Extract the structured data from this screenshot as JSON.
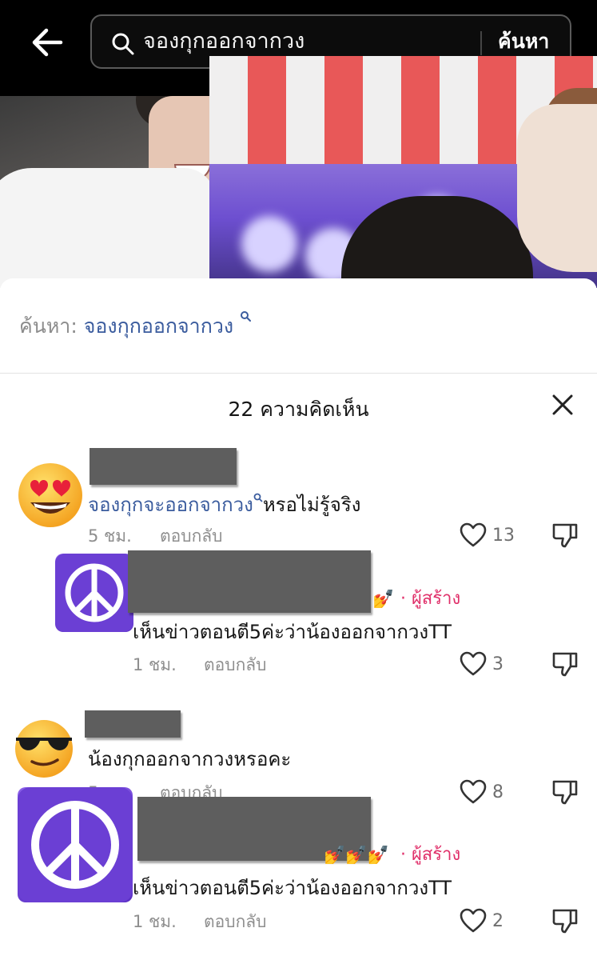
{
  "header": {
    "search_query": "จองกุกออกจากวง",
    "search_button": "ค้นหา"
  },
  "related_search": {
    "label": "ค้นหา:",
    "keyword": "จองกุกออกจากวง"
  },
  "comments_panel": {
    "count_label": "22 ความคิดเห็น"
  },
  "comments": [
    {
      "text_link": "จองกุกจะออกจากวง",
      "text_rest": "หรอไม่รู้จริง",
      "time": "5 ชม.",
      "reply": "ตอบกลับ",
      "likes": "13"
    },
    {
      "is_reply": true,
      "creator_badge": "· ผู้สร้าง",
      "text": "เห็นข่าวตอนตี5ค่ะว่าน้องออกจากวงTT",
      "time": "1 ชม.",
      "reply": "ตอบกลับ",
      "likes": "3"
    },
    {
      "text": "น้องกุกออกจากวงหรอคะ",
      "time": "5 ชม.",
      "reply": "ตอบกลับ",
      "likes": "8"
    },
    {
      "is_reply": true,
      "creator_badge": "· ผู้สร้าง",
      "text": "เห็นข่าวตอนตี5ค่ะว่าน้องออกจากวงTT",
      "time": "1 ชม.",
      "reply": "ตอบกลับ",
      "likes": "2"
    }
  ],
  "icons": {
    "back": "arrow-left-icon",
    "search": "search-icon",
    "close": "close-icon",
    "like": "heart-icon",
    "dislike": "thumbs-down-icon",
    "avatar1": "heart-eyes-emoji",
    "avatar2": "peace-symbol",
    "avatar3": "sunglasses-emoji"
  },
  "colors": {
    "link": "#3b5c9e",
    "creator": "#e0306a",
    "peace_bg": "#6b3fd4"
  }
}
